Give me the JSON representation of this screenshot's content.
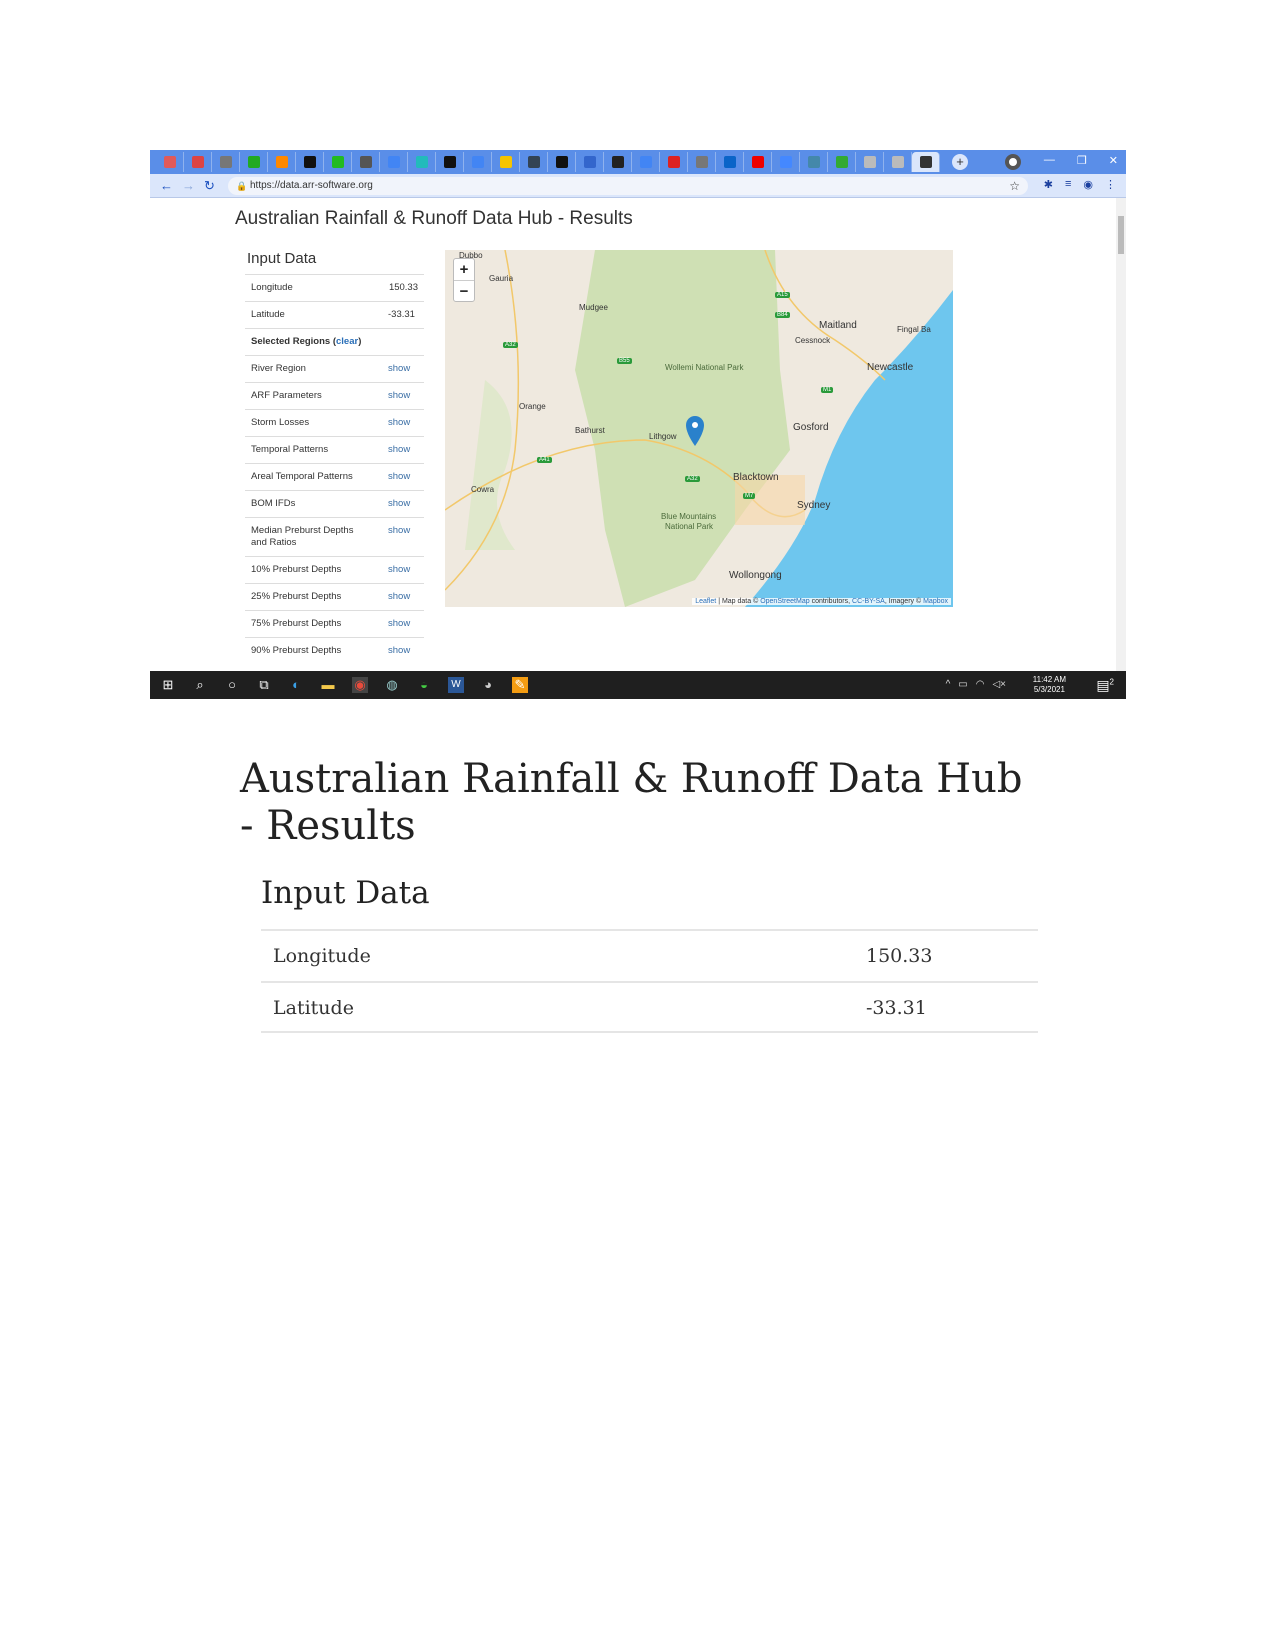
{
  "browser": {
    "tabs": [
      "pocket",
      "gmail",
      "mail",
      "green-circle",
      "sun",
      "a-logo",
      "green-badge",
      "globe",
      "google",
      "k-logo",
      "medium",
      "google",
      "k-yellow",
      "box",
      "medium",
      "k-blue",
      "github",
      "google",
      "pdf",
      "doc",
      "outlook",
      "youtube",
      "bookmark",
      "sync",
      "drive",
      "gear",
      "gear",
      "x"
    ],
    "url": "https://data.arr-software.org",
    "new_tab": "+"
  },
  "page": {
    "title": "Australian Rainfall & Runoff Data Hub - Results",
    "input_data_heading": "Input Data",
    "rows": [
      {
        "label": "Longitude",
        "value": "150.33"
      },
      {
        "label": "Latitude",
        "value": "-33.31"
      }
    ],
    "selected_regions": "Selected Regions (",
    "clear": "clear",
    "close_paren": ")",
    "show_rows": [
      {
        "label": "River Region",
        "link": "show"
      },
      {
        "label": "ARF Parameters",
        "link": "show"
      },
      {
        "label": "Storm Losses",
        "link": "show"
      },
      {
        "label": "Temporal Patterns",
        "link": "show"
      },
      {
        "label": "Areal Temporal Patterns",
        "link": "show"
      },
      {
        "label": "BOM IFDs",
        "link": "show"
      },
      {
        "label": "Median Preburst Depths and Ratios",
        "link": "show"
      },
      {
        "label": "10% Preburst Depths",
        "link": "show"
      },
      {
        "label": "25% Preburst Depths",
        "link": "show"
      },
      {
        "label": "75% Preburst Depths",
        "link": "show"
      },
      {
        "label": "90% Preburst Depths",
        "link": "show"
      }
    ],
    "map": {
      "zoom_in": "+",
      "zoom_out": "−",
      "labels": [
        "Dubbo",
        "Gauria",
        "Mudgee",
        "Maitland",
        "Fingal Ba",
        "Cessnock",
        "Newcastle",
        "Wollemi National Park",
        "Orange",
        "Bathurst",
        "Lithgow",
        "Gosford",
        "Blacktown",
        "Sydney",
        "Cowra",
        "Blue Mountains",
        "National Park",
        "Wollongong"
      ],
      "roads": [
        "A32",
        "A15",
        "B84",
        "B55",
        "M1",
        "A41",
        "A32",
        "M7"
      ],
      "attribution": {
        "leaflet": "Leaflet",
        "mid": " | Map data © ",
        "osm": "OpenStreetMap",
        "mid2": " contributors, ",
        "license": "CC-BY-SA",
        "mid3": ", Imagery © ",
        "mapbox": "Mapbox"
      },
      "colors": {
        "land": "#efe9df",
        "park": "#cfe0b4",
        "water": "#6ec6ee",
        "marker": "#2a81cb"
      }
    }
  },
  "taskbar": {
    "time": "11:42 AM",
    "date": "5/3/2021",
    "notifications": "2"
  },
  "document": {
    "title": "Australian Rainfall & Runoff Data Hub - Results",
    "subtitle": "Input Data",
    "rows": [
      {
        "label": "Longitude",
        "value": "150.33"
      },
      {
        "label": "Latitude",
        "value": "-33.31"
      }
    ]
  }
}
